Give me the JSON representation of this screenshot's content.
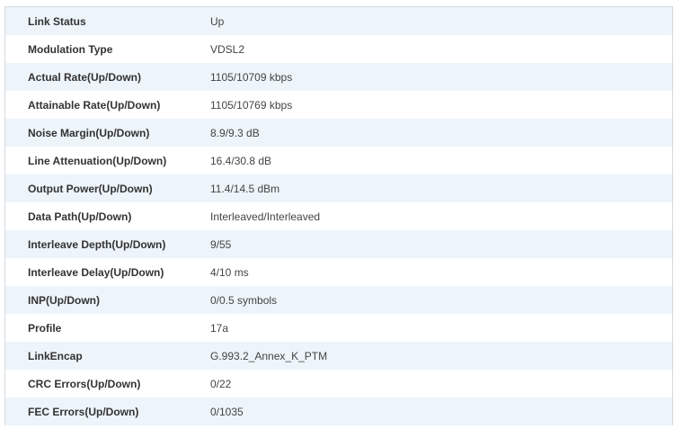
{
  "status_rows": [
    {
      "label": "Link Status",
      "value": "Up"
    },
    {
      "label": "Modulation Type",
      "value": "VDSL2"
    },
    {
      "label": "Actual Rate(Up/Down)",
      "value": "1105/10709 kbps"
    },
    {
      "label": "Attainable Rate(Up/Down)",
      "value": "1105/10769 kbps"
    },
    {
      "label": "Noise Margin(Up/Down)",
      "value": "8.9/9.3 dB"
    },
    {
      "label": "Line Attenuation(Up/Down)",
      "value": "16.4/30.8 dB"
    },
    {
      "label": "Output Power(Up/Down)",
      "value": "11.4/14.5 dBm"
    },
    {
      "label": "Data Path(Up/Down)",
      "value": "Interleaved/Interleaved"
    },
    {
      "label": "Interleave Depth(Up/Down)",
      "value": "9/55"
    },
    {
      "label": "Interleave Delay(Up/Down)",
      "value": "4/10 ms"
    },
    {
      "label": "INP(Up/Down)",
      "value": "0/0.5 symbols"
    },
    {
      "label": "Profile",
      "value": "17a"
    },
    {
      "label": "LinkEncap",
      "value": "G.993.2_Annex_K_PTM"
    },
    {
      "label": "CRC Errors(Up/Down)",
      "value": "0/22"
    },
    {
      "label": "FEC Errors(Up/Down)",
      "value": "0/1035"
    }
  ],
  "colors": {
    "row_stripe": "#edf4fa",
    "row_plain": "#ffffff",
    "border": "#d4d9de",
    "label_text": "#333333",
    "value_text": "#444444"
  }
}
